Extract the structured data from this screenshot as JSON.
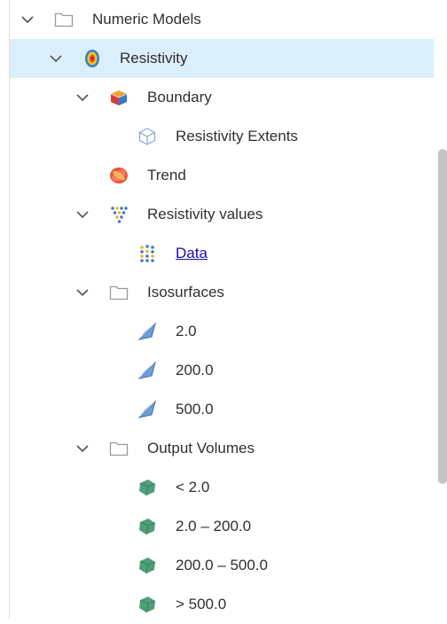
{
  "tree": {
    "items": [
      {
        "label": "Numeric Models",
        "icon": "folder-icon",
        "expanded": true,
        "selected": false
      },
      {
        "label": "Resistivity",
        "icon": "resistivity-model-icon",
        "expanded": true,
        "selected": true
      },
      {
        "label": "Boundary",
        "icon": "boundary-icon",
        "expanded": true,
        "selected": false
      },
      {
        "label": "Resistivity Extents",
        "icon": "extents-box-icon",
        "expanded": false,
        "selected": false
      },
      {
        "label": "Trend",
        "icon": "trend-icon",
        "expanded": false,
        "selected": false
      },
      {
        "label": "Resistivity values",
        "icon": "values-points-icon",
        "expanded": true,
        "selected": false
      },
      {
        "label": "Data",
        "icon": "data-points-icon",
        "expanded": false,
        "selected": false,
        "link": true
      },
      {
        "label": "Isosurfaces",
        "icon": "folder-icon",
        "expanded": true,
        "selected": false
      },
      {
        "label": "2.0",
        "icon": "isosurface-icon",
        "expanded": false,
        "selected": false
      },
      {
        "label": "200.0",
        "icon": "isosurface-icon",
        "expanded": false,
        "selected": false
      },
      {
        "label": "500.0",
        "icon": "isosurface-icon",
        "expanded": false,
        "selected": false
      },
      {
        "label": "Output Volumes",
        "icon": "folder-icon",
        "expanded": true,
        "selected": false
      },
      {
        "label": "< 2.0",
        "icon": "volume-icon",
        "expanded": false,
        "selected": false
      },
      {
        "label": "2.0 – 200.0",
        "icon": "volume-icon",
        "expanded": false,
        "selected": false
      },
      {
        "label": "200.0 – 500.0",
        "icon": "volume-icon",
        "expanded": false,
        "selected": false
      },
      {
        "label": "> 500.0",
        "icon": "volume-icon",
        "expanded": false,
        "selected": false
      }
    ]
  },
  "colors": {
    "selection": "#dbeefc",
    "link": "#1a0dab",
    "volume": "#4f9e7a",
    "isosurface": "#5a8fc6"
  }
}
